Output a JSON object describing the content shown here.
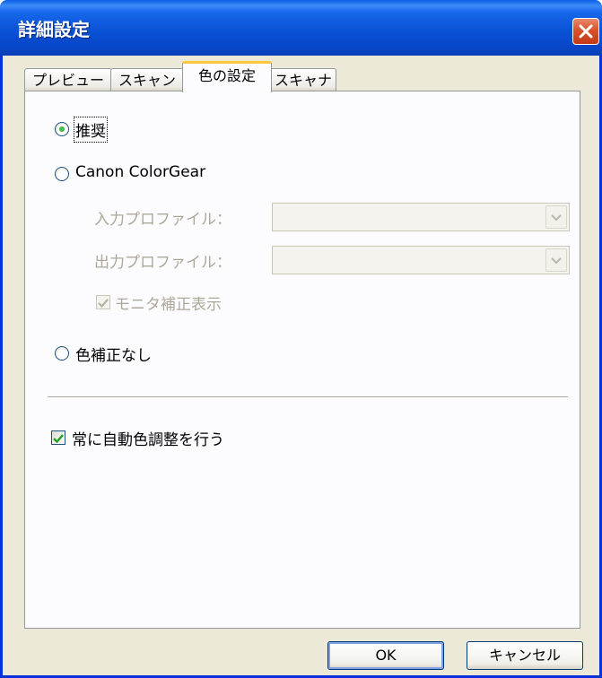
{
  "window": {
    "title": "詳細設定"
  },
  "tabs": [
    {
      "label": "プレビュー",
      "active": false
    },
    {
      "label": "スキャン",
      "active": false
    },
    {
      "label": "色の設定",
      "active": true
    },
    {
      "label": "スキャナ",
      "active": false
    }
  ],
  "color_settings": {
    "recommended_label": "推奨",
    "canon_colorgear_label": "Canon ColorGear",
    "input_profile_label": "入力プロファイル：",
    "input_profile_value": "",
    "output_profile_label": "出力プロファイル：",
    "output_profile_value": "",
    "monitor_correction_label": "モニタ補正表示",
    "no_correction_label": "色補正なし",
    "auto_color_adjust_label": "常に自動色調整を行う",
    "selected": "推奨"
  },
  "buttons": {
    "ok": "OK",
    "cancel": "キャンセル"
  },
  "colors": {
    "titlebar": "#0a52d6",
    "close": "#d8522b",
    "active_tab_accent": "#ffc83c",
    "check": "#21a121"
  },
  "icons": [
    "close-icon",
    "chevron-down-icon",
    "check-icon"
  ]
}
